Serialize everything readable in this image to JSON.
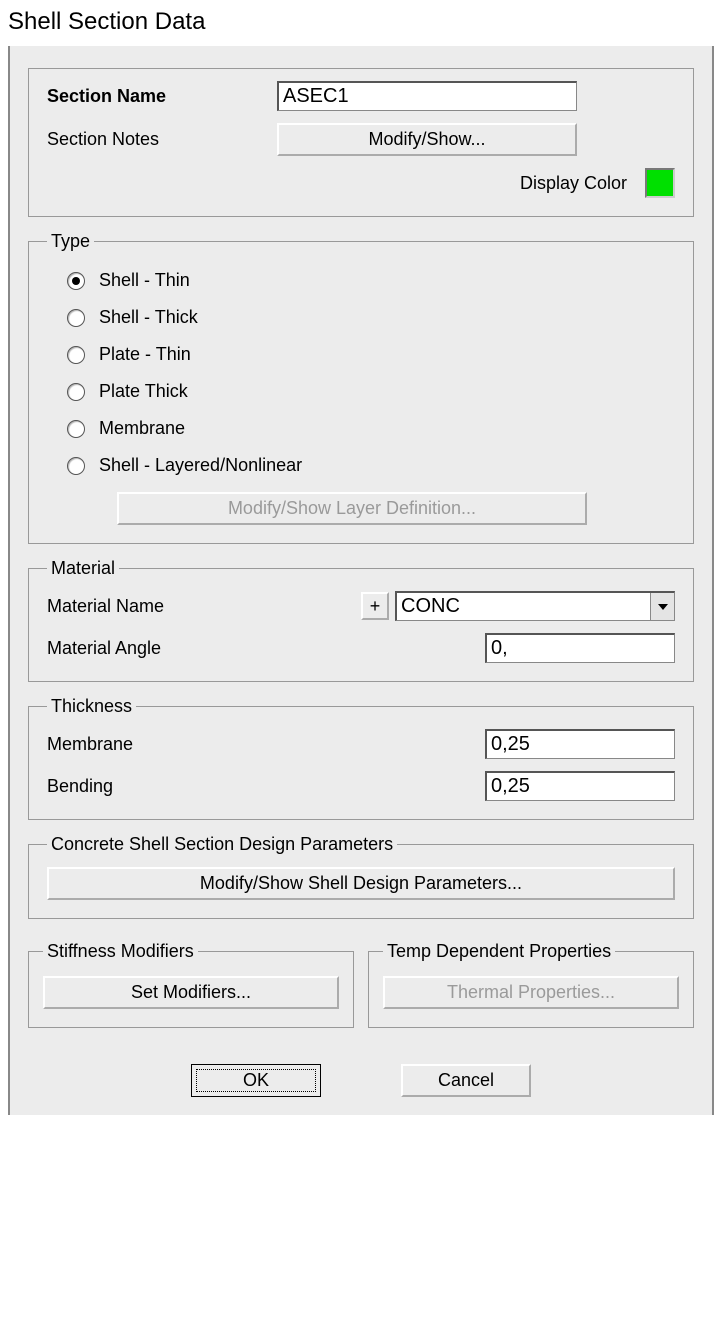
{
  "window_title": "Shell Section Data",
  "header": {
    "section_name_label": "Section Name",
    "section_name_value": "ASEC1",
    "section_notes_label": "Section Notes",
    "modify_show_btn": "Modify/Show...",
    "display_color_label": "Display Color",
    "display_color_value": "#00E000"
  },
  "type_group": {
    "legend": "Type",
    "options": [
      {
        "label": "Shell - Thin",
        "selected": true
      },
      {
        "label": "Shell - Thick",
        "selected": false
      },
      {
        "label": "Plate - Thin",
        "selected": false
      },
      {
        "label": "Plate Thick",
        "selected": false
      },
      {
        "label": "Membrane",
        "selected": false
      },
      {
        "label": "Shell - Layered/Nonlinear",
        "selected": false
      }
    ],
    "layer_btn": "Modify/Show Layer Definition..."
  },
  "material_group": {
    "legend": "Material",
    "name_label": "Material Name",
    "plus_label": "+",
    "name_value": "CONC",
    "angle_label": "Material Angle",
    "angle_value": "0,"
  },
  "thickness_group": {
    "legend": "Thickness",
    "membrane_label": "Membrane",
    "membrane_value": "0,25",
    "bending_label": "Bending",
    "bending_value": "0,25"
  },
  "design_group": {
    "legend": "Concrete Shell Section Design Parameters",
    "btn": "Modify/Show Shell Design Parameters..."
  },
  "stiffness_group": {
    "legend": "Stiffness Modifiers",
    "btn": "Set Modifiers..."
  },
  "temp_group": {
    "legend": "Temp Dependent Properties",
    "btn": "Thermal Properties..."
  },
  "footer": {
    "ok": "OK",
    "cancel": "Cancel"
  }
}
